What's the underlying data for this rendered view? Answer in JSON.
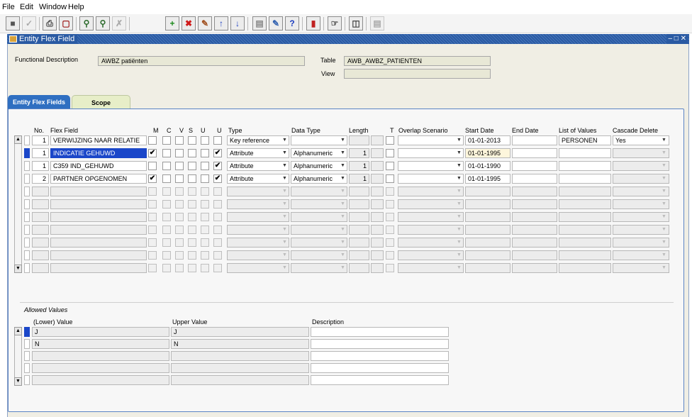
{
  "menu": [
    "File",
    "Edit",
    "Window",
    "Help"
  ],
  "window": {
    "title": "Entity Flex Field",
    "controls": "– □ ✕"
  },
  "header": {
    "functional_description_label": "Functional Description",
    "functional_description_value": "AWBZ patiënten",
    "table_label": "Table",
    "table_value": "AWB_AWBZ_PATIENTEN",
    "view_label": "View",
    "view_value": ""
  },
  "tabs": [
    {
      "label": "Entity Flex Fields",
      "active": true
    },
    {
      "label": "Scope",
      "active": false
    }
  ],
  "grid": {
    "columns": {
      "no": "No.",
      "flex_field": "Flex Field",
      "m": "M",
      "c": "C",
      "v": "V",
      "s": "S",
      "u1": "U",
      "u2": "U",
      "type": "Type",
      "data_type": "Data Type",
      "length": "Length",
      "t": "T",
      "overlap": "Overlap Scenario",
      "start": "Start Date",
      "end": "End Date",
      "lov": "List of Values",
      "cascade": "Cascade Delete"
    },
    "rows": [
      {
        "no": "1",
        "flex_field": "VERWIJZING NAAR RELATIE",
        "m": false,
        "c": false,
        "v": false,
        "s": false,
        "u1": false,
        "u2": false,
        "type": "Key reference",
        "data_type": "",
        "length": "",
        "t": false,
        "overlap": "",
        "start": "01-01-2013",
        "end": "",
        "lov": "PERSONEN",
        "cascade": "Yes"
      },
      {
        "no": "1",
        "flex_field": "INDICATIE GEHUWD",
        "m": true,
        "c": false,
        "v": false,
        "s": false,
        "u1": false,
        "u2": true,
        "type": "Attribute",
        "data_type": "Alphanumeric",
        "length": "1",
        "t": false,
        "overlap": "",
        "start": "01-01-1995",
        "end": "",
        "lov": "",
        "cascade": ""
      },
      {
        "no": "1",
        "flex_field": "C359 IND_GEHUWD",
        "m": false,
        "c": false,
        "v": false,
        "s": false,
        "u1": false,
        "u2": true,
        "type": "Attribute",
        "data_type": "Alphanumeric",
        "length": "1",
        "t": false,
        "overlap": "",
        "start": "01-01-1990",
        "end": "",
        "lov": "",
        "cascade": ""
      },
      {
        "no": "2",
        "flex_field": "PARTNER OPGENOMEN",
        "m": true,
        "c": false,
        "v": false,
        "s": false,
        "u1": false,
        "u2": true,
        "type": "Attribute",
        "data_type": "Alphanumeric",
        "length": "1",
        "t": false,
        "overlap": "",
        "start": "01-01-1995",
        "end": "",
        "lov": "",
        "cascade": ""
      }
    ],
    "selected_row": 1,
    "total_rows": 11
  },
  "allowed": {
    "section_label": "Allowed Values",
    "columns": {
      "lower": "(Lower) Value",
      "upper": "Upper Value",
      "description": "Description"
    },
    "rows": [
      {
        "lower": "J",
        "upper": "J",
        "description": ""
      },
      {
        "lower": "N",
        "upper": "N",
        "description": ""
      }
    ],
    "total_rows": 5
  },
  "colors": {
    "selection": "#1b47c9",
    "titlebar": "#2a5aa3",
    "tab_active": "#2f6fc1",
    "tab_inactive": "#e7eec8"
  }
}
